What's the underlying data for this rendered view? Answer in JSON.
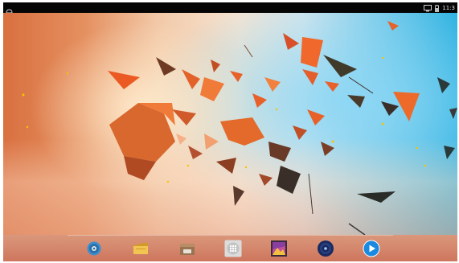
{
  "status_bar": {
    "time": "11:3",
    "left_icon": "notification-icon",
    "right_icons": [
      "screen-cast-icon",
      "battery-icon"
    ]
  },
  "wallpaper": {
    "name": "android-shattered-shards-wallpaper",
    "colors": {
      "warm": "#d97040",
      "light": "#f6e4d2",
      "cool": "#29b0e0",
      "shard": "#e8602a",
      "dark_shard": "#3a2e28"
    }
  },
  "dock": {
    "apps": [
      {
        "name": "settings-icon",
        "color": "#3a8fd0"
      },
      {
        "name": "file-manager-icon",
        "color": "#e8b23a"
      },
      {
        "name": "apk-installer-icon",
        "color": "#8a6a4a"
      },
      {
        "name": "app-drawer-icon",
        "color": "#dcdcdc"
      },
      {
        "name": "gallery-icon",
        "color": "#8a3fa0"
      },
      {
        "name": "music-icon",
        "color": "#1a2a60"
      },
      {
        "name": "video-player-icon",
        "color": "#1a8ae0"
      }
    ]
  }
}
